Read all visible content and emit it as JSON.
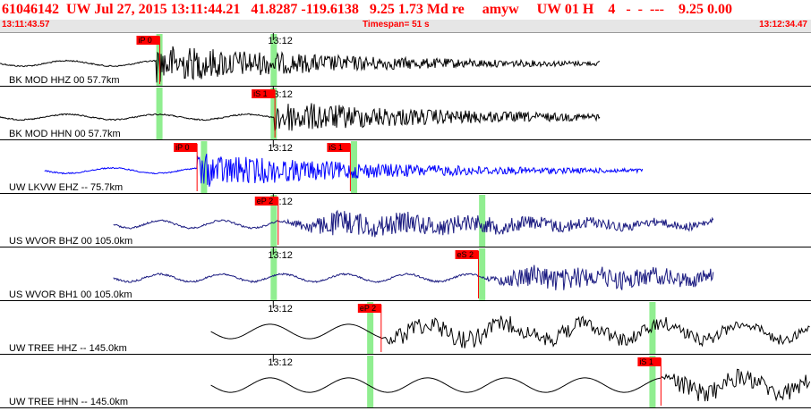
{
  "header": {
    "title": "61046142  UW Jul 27, 2015 13:11:44.21   41.8287 -119.6138   9.25 1.73 Md re     amyw     UW 01 H    4   -  -  ---    9.25 0.00",
    "start_time": "13:11:43.57",
    "timespan": "Timespan=  51 s",
    "end_time": "13:12:34.47"
  },
  "colors": {
    "title": "#ff0000",
    "bar_bg": "#e6e6e6",
    "pick_box": "#ff0000",
    "pick_line": "#ff0000",
    "window_green": "#90ee90",
    "black_trace": "#000000",
    "blue_trace": "#0000ff",
    "navy_trace": "#1a1a80"
  },
  "panels": [
    {
      "label": "BK MOD HHZ 00 57.7km",
      "tick_label": "13:12",
      "color": "black",
      "start": 0.0,
      "onset": 0.193,
      "end": 0.74,
      "amp": 1.0,
      "style": "impulsive",
      "picks": [
        {
          "text": "iP 0",
          "t": 0.197
        }
      ],
      "windows": [
        0.196,
        0.337
      ]
    },
    {
      "label": "BK MOD HHN 00 57.7km",
      "tick_label": "13:12",
      "color": "black",
      "start": 0.0,
      "onset": 0.338,
      "end": 0.74,
      "amp": 0.85,
      "style": "impulsive",
      "picks": [
        {
          "text": "iS 1",
          "t": 0.339
        }
      ],
      "windows": [
        0.196,
        0.337
      ]
    },
    {
      "label": "UW LKVW EHZ -- 75.7km",
      "tick_label": "13:12",
      "color": "blue",
      "start": 0.055,
      "onset": 0.243,
      "end": 0.793,
      "amp": 0.9,
      "style": "impulsive",
      "picks": [
        {
          "text": "iP 0",
          "t": 0.243
        },
        {
          "text": "iS 1",
          "t": 0.432
        }
      ],
      "windows": [
        0.251,
        0.436
      ]
    },
    {
      "label": "US WVOR BHZ 00 105.0km",
      "tick_label": "13:12",
      "color": "navy",
      "start": 0.14,
      "onset": 0.345,
      "end": 0.88,
      "amp": 0.85,
      "style": "emergent",
      "picks": [
        {
          "text": "eP 2",
          "t": 0.343
        }
      ],
      "windows": [
        0.337,
        0.594
      ]
    },
    {
      "label": "US WVOR BH1 00 105.0km",
      "tick_label": "13:12",
      "color": "navy",
      "start": 0.14,
      "onset": 0.59,
      "end": 0.88,
      "amp": 0.85,
      "style": "emergent",
      "picks": [
        {
          "text": "eS 2",
          "t": 0.59
        }
      ],
      "windows": [
        0.337,
        0.594
      ]
    },
    {
      "label": "UW TREE HHZ -- 145.0km",
      "tick_label": "13:12",
      "color": "black",
      "start": 0.26,
      "onset": 0.47,
      "end": 1.0,
      "amp": 0.95,
      "style": "longperiod",
      "picks": [
        {
          "text": "eP 2",
          "t": 0.47
        }
      ],
      "windows": [
        0.456,
        0.804
      ]
    },
    {
      "label": "UW TREE HHN -- 145.0km",
      "tick_label": "13:12",
      "color": "black",
      "start": 0.26,
      "onset": 0.815,
      "end": 1.0,
      "amp": 0.95,
      "style": "longperiod",
      "picks": [
        {
          "text": "iS 1",
          "t": 0.815
        }
      ],
      "windows": [
        0.456,
        0.804
      ]
    }
  ]
}
